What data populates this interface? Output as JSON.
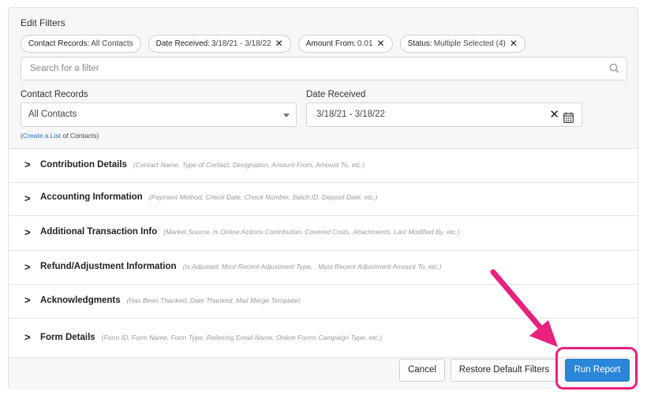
{
  "title": "Edit Filters",
  "chips": [
    {
      "name": "Contact Records:",
      "value": "All Contacts",
      "removable": false
    },
    {
      "name": "Date Received:",
      "value": "3/18/21 - 3/18/22",
      "removable": true
    },
    {
      "name": "Amount From:",
      "value": "0.01",
      "removable": true
    },
    {
      "name": "Status:",
      "value": "Multiple Selected (4)",
      "removable": true
    }
  ],
  "search": {
    "placeholder": "Search for a filter"
  },
  "contact_records": {
    "label": "Contact Records",
    "value": "All Contacts"
  },
  "date_received": {
    "label": "Date Received",
    "value": "3/18/21 - 3/18/22"
  },
  "hint": {
    "open": "(",
    "link": "Create a List",
    "rest": " of Contacts)"
  },
  "sections": [
    {
      "name": "Contribution Details",
      "desc": "(Contact Name, Type of Contact, Designation, Amount From, Amount To, etc.)"
    },
    {
      "name": "Accounting Information",
      "desc": "(Payment Method, Check Date, Check Number, Batch ID, Deposit Date, etc.)"
    },
    {
      "name": "Additional Transaction Info",
      "desc": "(Market Source, Is Online Actions Contribution, Covered Costs, Attachments, Last Modified By, etc.)"
    },
    {
      "name": "Refund/Adjustment Information",
      "desc": "(Is Adjusted, Most Recent Adjustment Type, , Most Recent Adjustment Amount To, etc.)"
    },
    {
      "name": "Acknowledgments",
      "desc": "(Has Been Thanked, Date Thanked, Mail Merge Template)"
    },
    {
      "name": "Form Details",
      "desc": "(Form ID, Form Name, Form Type, Referring Email Name, Online Forms Campaign Type, etc.)"
    }
  ],
  "buttons": {
    "cancel": "Cancel",
    "restore": "Restore Default Filters",
    "run": "Run Report"
  },
  "icons": {
    "chevron": "chevron-right-icon",
    "search": "search-icon",
    "calendar": "calendar-icon",
    "clear": "close-icon"
  },
  "colors": {
    "primary": "#2a86d8",
    "highlight": "#e8217e",
    "link": "#1a73c8"
  }
}
